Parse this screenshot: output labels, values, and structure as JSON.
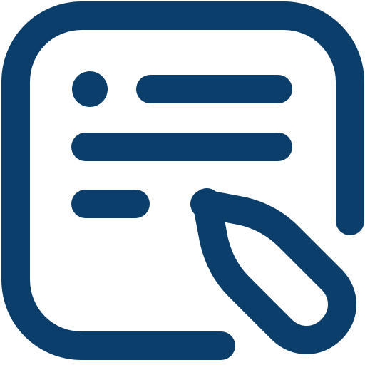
{
  "icon": {
    "name": "note-edit-icon",
    "color": "#0b3e6b",
    "background": "#ffffff"
  }
}
